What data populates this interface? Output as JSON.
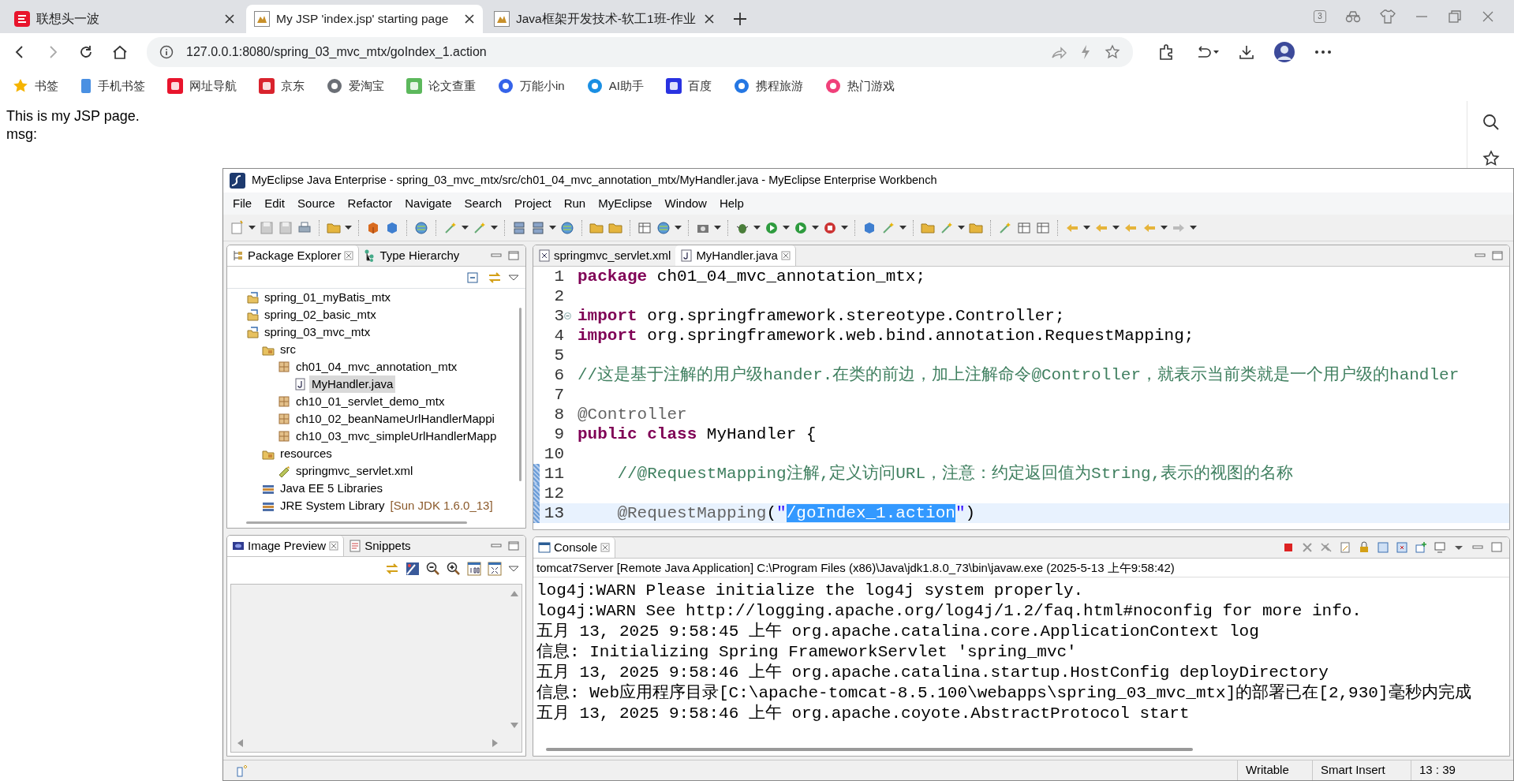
{
  "browser": {
    "tabs": [
      {
        "label": "联想头一波",
        "kind": "portal",
        "selected": false
      },
      {
        "label": "My JSP 'index.jsp' starting page",
        "kind": "tomcat",
        "selected": true
      },
      {
        "label": "Java框架开发技术-软工1班-作业",
        "kind": "tomcat",
        "selected": false
      }
    ],
    "tab_count": "3",
    "address": "127.0.0.1:8080/spring_03_mvc_mtx/goIndex_1.action",
    "bookmarks": [
      {
        "label": "书签",
        "kind": "star",
        "color": "#f5b400"
      },
      {
        "label": "手机书签",
        "kind": "phone",
        "color": "#4a90e2"
      },
      {
        "label": "网址导航",
        "kind": "tile",
        "color": "#e8142c"
      },
      {
        "label": "京东",
        "kind": "tile",
        "color": "#d9232d"
      },
      {
        "label": "爱淘宝",
        "kind": "round",
        "color": "#6b6f76"
      },
      {
        "label": "论文查重",
        "kind": "tile",
        "color": "#5cb85c"
      },
      {
        "label": "万能小in",
        "kind": "round",
        "color": "#3563e9"
      },
      {
        "label": "AI助手",
        "kind": "round",
        "color": "#1a8fe3"
      },
      {
        "label": "百度",
        "kind": "tile",
        "color": "#2932e1"
      },
      {
        "label": "携程旅游",
        "kind": "round",
        "color": "#2577e3"
      },
      {
        "label": "热门游戏",
        "kind": "round",
        "color": "#f0407a"
      }
    ]
  },
  "page": {
    "lines": [
      "This is my JSP page.",
      "msg:"
    ]
  },
  "ide": {
    "title": "MyEclipse Java Enterprise - spring_03_mvc_mtx/src/ch01_04_mvc_annotation_mtx/MyHandler.java - MyEclipse Enterprise Workbench",
    "menu": [
      "File",
      "Edit",
      "Source",
      "Refactor",
      "Navigate",
      "Search",
      "Project",
      "Run",
      "MyEclipse",
      "Window",
      "Help"
    ],
    "explorer": {
      "tabs": [
        {
          "label": "Package Explorer",
          "kind": "packages",
          "selected": true
        },
        {
          "label": "Type Hierarchy",
          "kind": "hierarchy",
          "selected": false
        }
      ],
      "tree": [
        {
          "label": "spring_01_myBatis_mtx",
          "kind": "project",
          "selected": false
        },
        {
          "label": "spring_02_basic_mtx",
          "kind": "project",
          "selected": false
        },
        {
          "label": "spring_03_mvc_mtx",
          "kind": "project",
          "selected": false,
          "children": [
            {
              "label": "src",
              "kind": "source-folder",
              "selected": false,
              "children": [
                {
                  "label": "ch01_04_mvc_annotation_mtx",
                  "kind": "package",
                  "selected": false,
                  "children": [
                    {
                      "label": "MyHandler.java",
                      "kind": "java-file",
                      "selected": true
                    }
                  ]
                },
                {
                  "label": "ch10_01_servlet_demo_mtx",
                  "kind": "package",
                  "selected": false
                },
                {
                  "label": "ch10_02_beanNameUrlHandlerMappi",
                  "kind": "package",
                  "selected": false
                },
                {
                  "label": "ch10_03_mvc_simpleUrlHandlerMapp",
                  "kind": "package",
                  "selected": false
                }
              ]
            },
            {
              "label": "resources",
              "kind": "source-folder",
              "selected": false,
              "children": [
                {
                  "label": "springmvc_servlet.xml",
                  "kind": "xml-file",
                  "selected": false
                }
              ]
            },
            {
              "label": "Java EE 5 Libraries",
              "kind": "library",
              "selected": false
            },
            {
              "label": "JRE System Library",
              "suffix": "[Sun JDK 1.6.0_13]",
              "kind": "library",
              "selected": false
            }
          ]
        }
      ]
    },
    "preview": {
      "tabs": [
        {
          "label": "Image Preview",
          "kind": "image",
          "selected": true
        },
        {
          "label": "Snippets",
          "kind": "snippets",
          "selected": false
        }
      ]
    },
    "editor": {
      "tabs": [
        {
          "label": "springmvc_servlet.xml",
          "kind": "xml",
          "selected": false
        },
        {
          "label": "MyHandler.java",
          "kind": "java",
          "selected": true
        }
      ],
      "lines": [
        {
          "number": "1",
          "current": false,
          "marked": false,
          "fold": false,
          "tokens": [
            {
              "kind": "keyword",
              "text": "package"
            },
            {
              "kind": "plain",
              "text": " ch01_04_mvc_annotation_mtx;"
            }
          ]
        },
        {
          "number": "2",
          "current": false,
          "marked": false,
          "fold": false
        },
        {
          "number": "3",
          "current": false,
          "marked": false,
          "fold": true,
          "tokens": [
            {
              "kind": "keyword",
              "text": "import"
            },
            {
              "kind": "plain",
              "text": " org.springframework.stereotype.Controller;"
            }
          ]
        },
        {
          "number": "4",
          "current": false,
          "marked": false,
          "fold": false,
          "tokens": [
            {
              "kind": "keyword",
              "text": "import"
            },
            {
              "kind": "plain",
              "text": " org.springframework.web.bind.annotation.RequestMapping;"
            }
          ]
        },
        {
          "number": "5",
          "current": false,
          "marked": false,
          "fold": false
        },
        {
          "number": "6",
          "current": false,
          "marked": false,
          "fold": false,
          "tokens": [
            {
              "kind": "comment",
              "text": "//这是基于注解的用户级hander.在类的前边，加上注解命令@Controller，就表示当前类就是一个用户级的handler"
            }
          ]
        },
        {
          "number": "7",
          "current": false,
          "marked": false,
          "fold": false
        },
        {
          "number": "8",
          "current": false,
          "marked": false,
          "fold": false,
          "tokens": [
            {
              "kind": "annotation",
              "text": "@Controller"
            }
          ]
        },
        {
          "number": "9",
          "current": false,
          "marked": false,
          "fold": false,
          "tokens": [
            {
              "kind": "keyword",
              "text": "public"
            },
            {
              "kind": "keyword",
              "text": " class"
            },
            {
              "kind": "plain",
              "text": " MyHandler {"
            }
          ]
        },
        {
          "number": "10",
          "current": false,
          "marked": false,
          "fold": false
        },
        {
          "number": "11",
          "current": false,
          "marked": true,
          "fold": false,
          "tokens": [
            {
              "kind": "comment",
              "text": "    //@RequestMapping注解,定义访问URL，注意：约定返回值为String,表示的视图的名称"
            }
          ]
        },
        {
          "number": "12",
          "current": false,
          "marked": true,
          "fold": false
        },
        {
          "number": "13",
          "current": true,
          "marked": true,
          "fold": false,
          "tokens": [
            {
              "kind": "annotation",
              "text": "    @RequestMapping"
            },
            {
              "kind": "plain",
              "text": "("
            },
            {
              "kind": "string",
              "text": "\""
            },
            {
              "kind": "selected",
              "text": "/goIndex_1.action"
            },
            {
              "kind": "string",
              "text": "\""
            },
            {
              "kind": "plain",
              "text": ")"
            }
          ]
        }
      ]
    },
    "console": {
      "tab": "Console",
      "process": "tomcat7Server [Remote Java Application] C:\\Program Files (x86)\\Java\\jdk1.8.0_73\\bin\\javaw.exe (2025-5-13 上午9:58:42)",
      "lines": [
        "log4j:WARN Please initialize the log4j system properly.",
        "log4j:WARN See http://logging.apache.org/log4j/1.2/faq.html#noconfig for more info.",
        "五月 13, 2025 9:58:45 上午 org.apache.catalina.core.ApplicationContext log",
        "信息: Initializing Spring FrameworkServlet 'spring_mvc'",
        "五月 13, 2025 9:58:46 上午 org.apache.catalina.startup.HostConfig deployDirectory",
        "信息: Web应用程序目录[C:\\apache-tomcat-8.5.100\\webapps\\spring_03_mvc_mtx]的部署已在[2,930]毫秒内完成",
        "五月 13, 2025 9:58:46 上午 org.apache.coyote.AbstractProtocol start"
      ]
    },
    "status_bar": [
      "Writable",
      "Smart Insert",
      "13 : 39"
    ]
  }
}
